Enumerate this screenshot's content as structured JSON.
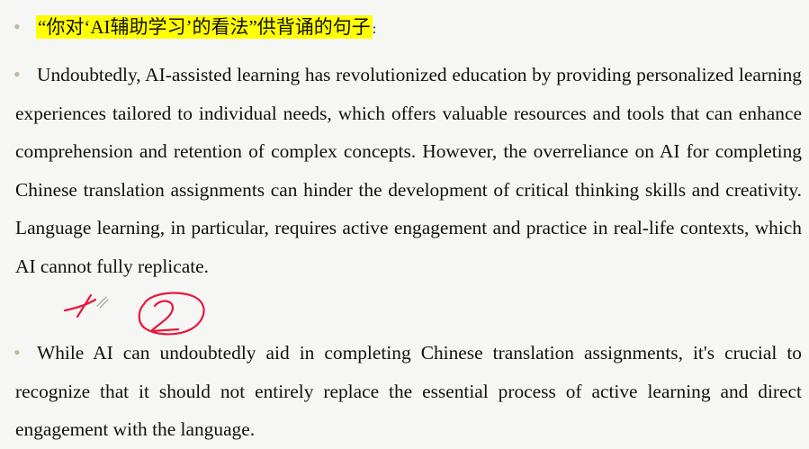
{
  "heading": {
    "highlighted_text": "“你对‘AI辅助学习’的看法”供背诵的句子",
    "suffix": ":"
  },
  "paragraphs": [
    "Undoubtedly, AI-assisted learning has revolutionized education by providing personalized learning experiences tailored to individual needs, which offers valuable resources and tools that can enhance comprehension and retention of complex concepts. However, the overreliance on AI for completing Chinese translation assignments can hinder the development of critical thinking skills and creativity. Language learning, in particular, requires active engagement and practice in real-life contexts, which AI cannot fully replicate.",
    "While AI can undoubtedly aid in completing Chinese translation assignments, it's crucial to recognize that it should not entirely replace the essential process of active learning and direct engagement with the language."
  ],
  "colors": {
    "background": "#f6f6f4",
    "text": "#111111",
    "bullet": "#c7b79a",
    "highlight": "#ffff00",
    "ink_annotation": "#e8173c"
  }
}
